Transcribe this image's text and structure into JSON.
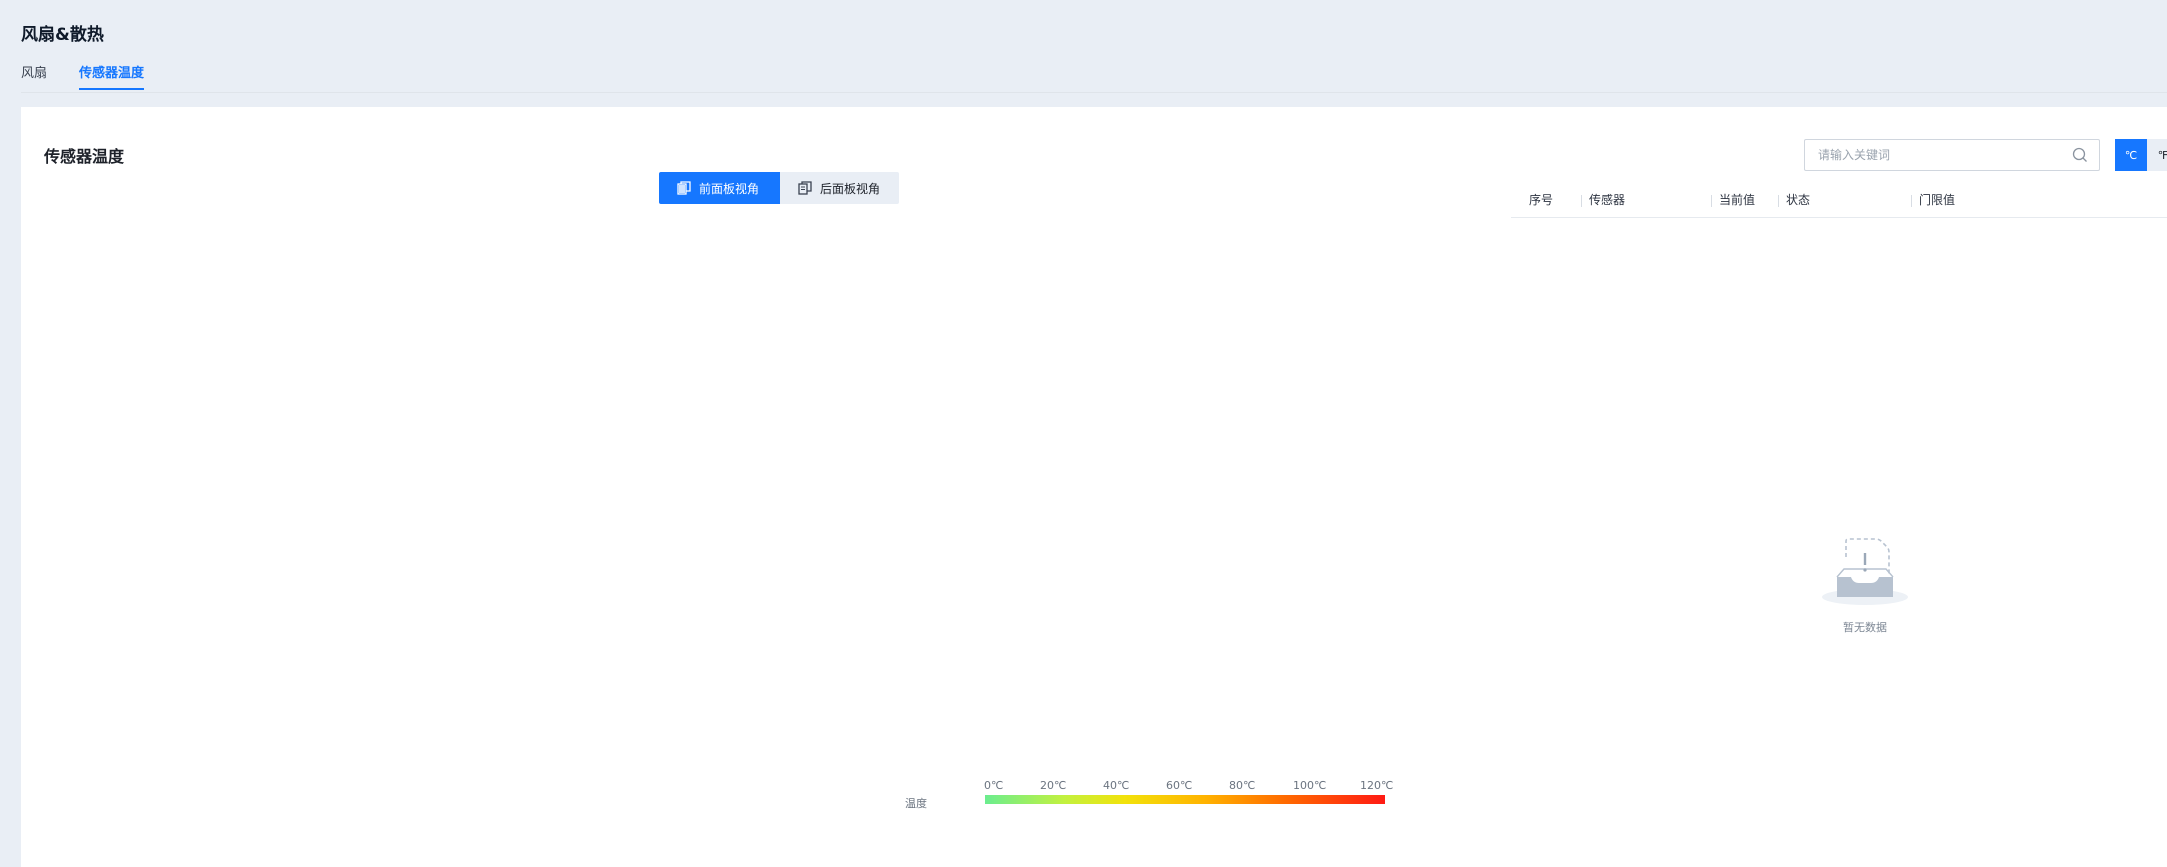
{
  "page": {
    "title": "风扇&散热"
  },
  "tabs": [
    {
      "label": "风扇",
      "active": false
    },
    {
      "label": "传感器温度",
      "active": true
    }
  ],
  "card": {
    "title": "传感器温度",
    "view_switch": {
      "front_label": "前面板视角",
      "back_label": "后面板视角",
      "selected": "前面板视角"
    }
  },
  "search": {
    "placeholder": "请输入关键词",
    "value": ""
  },
  "unit_switch": {
    "celsius": "℃",
    "fahrenheit": "℉",
    "selected": "℃"
  },
  "table": {
    "columns": [
      "序号",
      "传感器",
      "当前值",
      "状态",
      "门限值"
    ],
    "rows": [],
    "empty_text": "暂无数据"
  },
  "legend": {
    "title": "温度",
    "ticks": [
      "0℃",
      "20℃",
      "40℃",
      "60℃",
      "80℃",
      "100℃",
      "120℃"
    ]
  },
  "colors": {
    "accent": "#1677ff",
    "page_bg": "#e9eef5",
    "card_bg": "#ffffff",
    "gradient": [
      "#6bed8f",
      "#c3f13e",
      "#f2e20b",
      "#ffb300",
      "#ff6a00",
      "#ff1a14"
    ]
  },
  "icons": {
    "search": "search-icon",
    "front_view": "front-panel-icon",
    "back_view": "back-panel-icon",
    "empty": "empty-box-icon"
  }
}
